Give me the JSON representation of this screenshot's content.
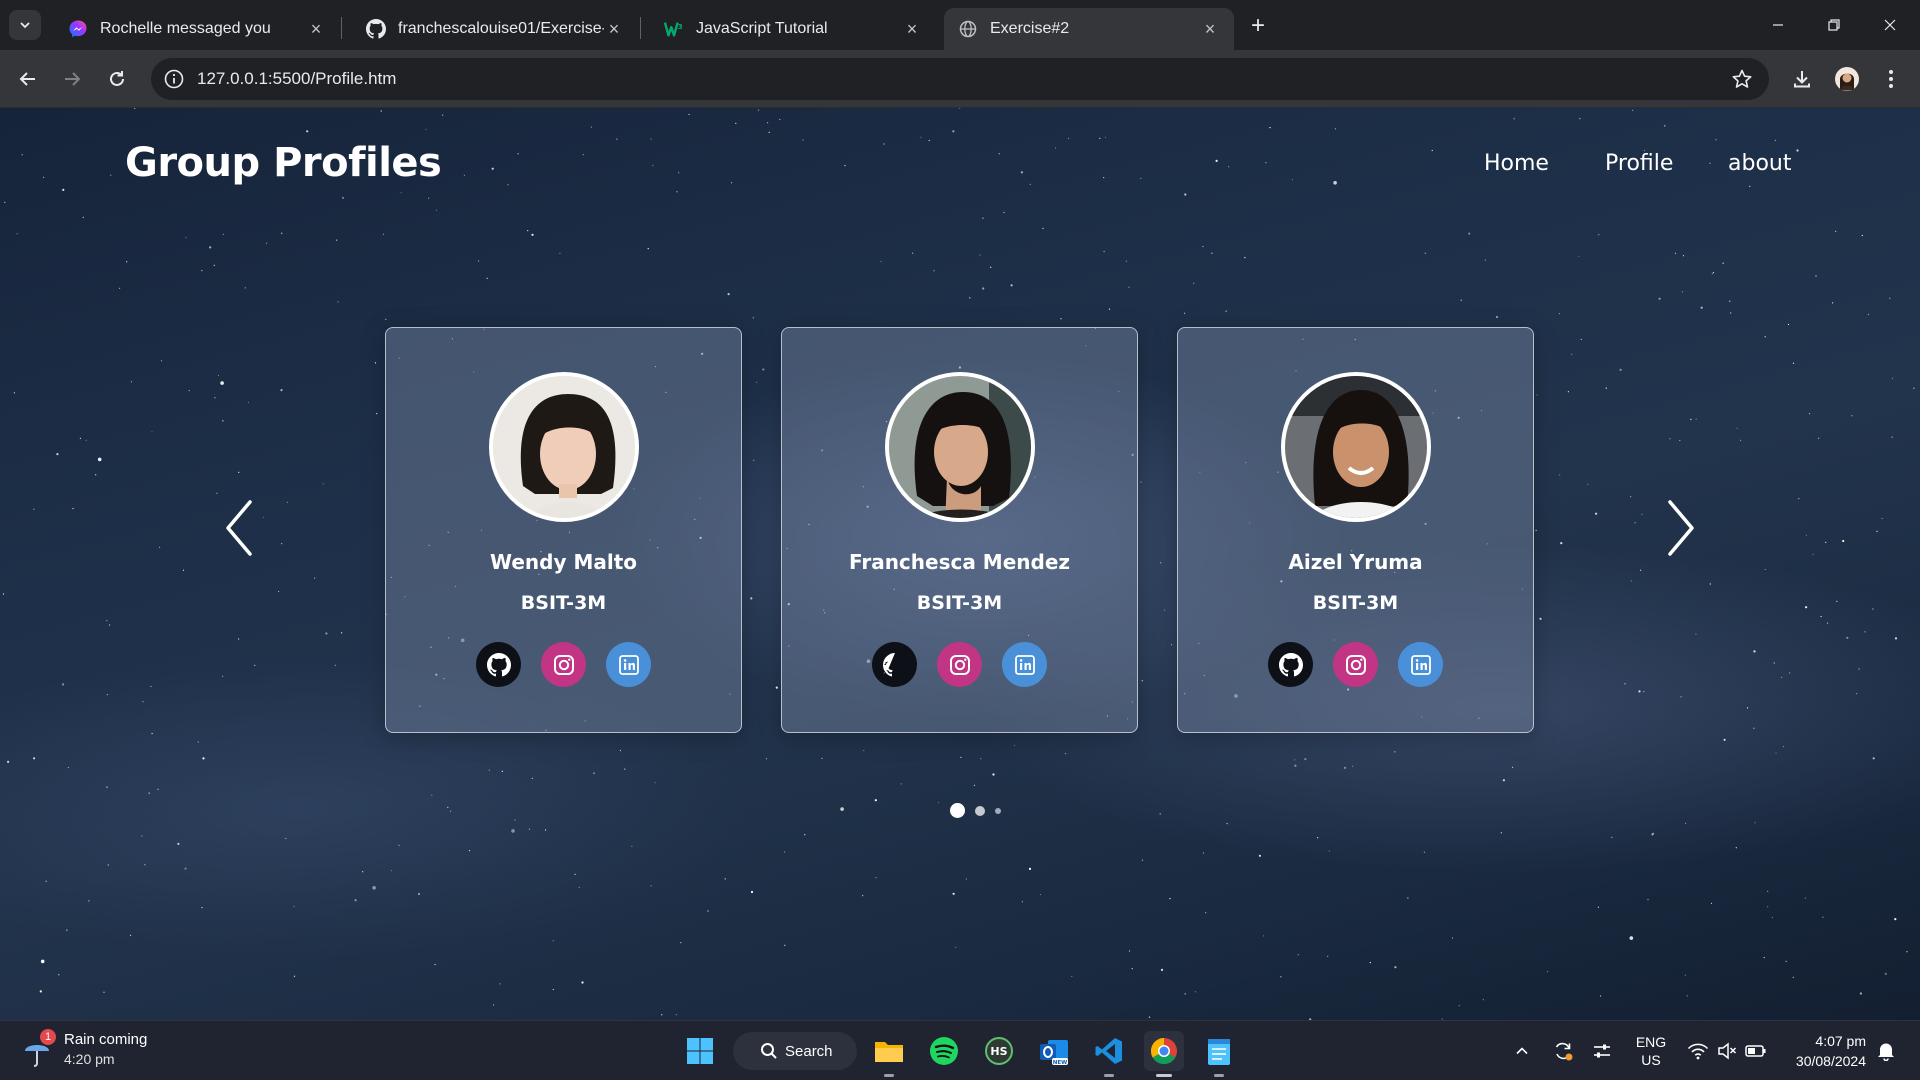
{
  "browser": {
    "tabs": [
      {
        "title": "Rochelle messaged you",
        "icon": "messenger-icon",
        "active": false
      },
      {
        "title": "franchescalouise01/Exercise-2",
        "icon": "github-icon",
        "active": false
      },
      {
        "title": "JavaScript Tutorial",
        "icon": "w3schools-icon",
        "active": false
      },
      {
        "title": "Exercise#2",
        "icon": "globe-icon",
        "active": true
      }
    ],
    "url": "127.0.0.1:5500/Profile.htm"
  },
  "page": {
    "title": "Group Profiles",
    "nav": [
      "Home",
      "Profile",
      "about"
    ],
    "profiles": [
      {
        "name": "Wendy Malto",
        "course": "BSIT-3M"
      },
      {
        "name": "Franchesca Mendez",
        "course": "BSIT-3M"
      },
      {
        "name": "Aizel Yruma",
        "course": "BSIT-3M"
      }
    ],
    "carousel": {
      "current_page": 1,
      "total_pages": 3
    }
  },
  "taskbar": {
    "weather_title": "Rain coming",
    "weather_time": "4:20 pm",
    "weather_badge": "1",
    "search_label": "Search",
    "lang_line1": "ENG",
    "lang_line2": "US",
    "time": "4:07 pm",
    "date": "30/08/2024"
  },
  "colors": {
    "github": "#0d1117",
    "instagram": "#c13584",
    "linkedin": "#4a90d9"
  }
}
